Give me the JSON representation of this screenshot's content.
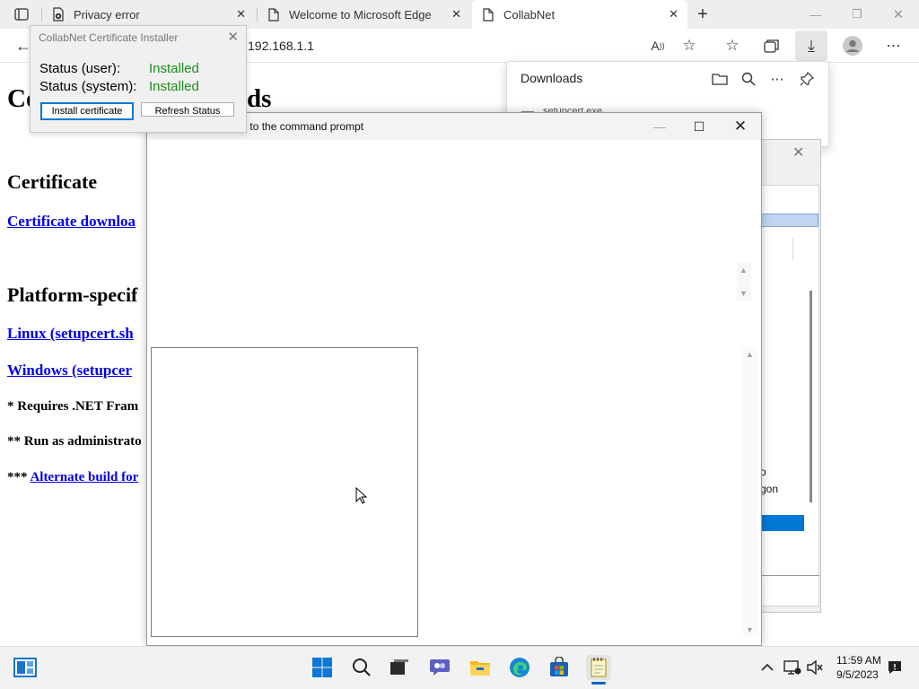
{
  "browser": {
    "tabs": [
      {
        "title": "Privacy error",
        "icon": "warning-doc-icon"
      },
      {
        "title": "Welcome to Microsoft Edge",
        "icon": "page-icon"
      },
      {
        "title": "CollabNet",
        "icon": "page-icon"
      }
    ],
    "address": "192.168.1.1"
  },
  "page": {
    "heading_start": "Co",
    "heading_end": "ds",
    "certificate_heading": "Certificate",
    "certificate_link": "Certificate downloa",
    "platform_heading": "Platform-specif",
    "linux_link": "Linux (setupcert.sh",
    "windows_link": "Windows (setupcer",
    "note1": "* Requires .NET Fram",
    "note2": "** Run as administrato",
    "note3_prefix": "*** ",
    "note3_link": "Alternate build for"
  },
  "installer": {
    "title": "CollabNet Certificate Installer",
    "status_user_label": "Status (user):",
    "status_user_value": "Installed",
    "status_system_label": "Status (system):",
    "status_system_value": "Installed",
    "install_button": "Install certificate",
    "refresh_button": "Refresh Status",
    "status_color": "#1a8f1a"
  },
  "downloads": {
    "title": "Downloads",
    "file": "setupcert.exe"
  },
  "background_dialog": {
    "text1": "o",
    "text2": "gon"
  },
  "gpo_window": {
    "title": "Prevent access to the command prompt"
  },
  "taskbar": {
    "time": "11:59 AM",
    "date": "9/5/2023",
    "accent": "#0067c0"
  }
}
